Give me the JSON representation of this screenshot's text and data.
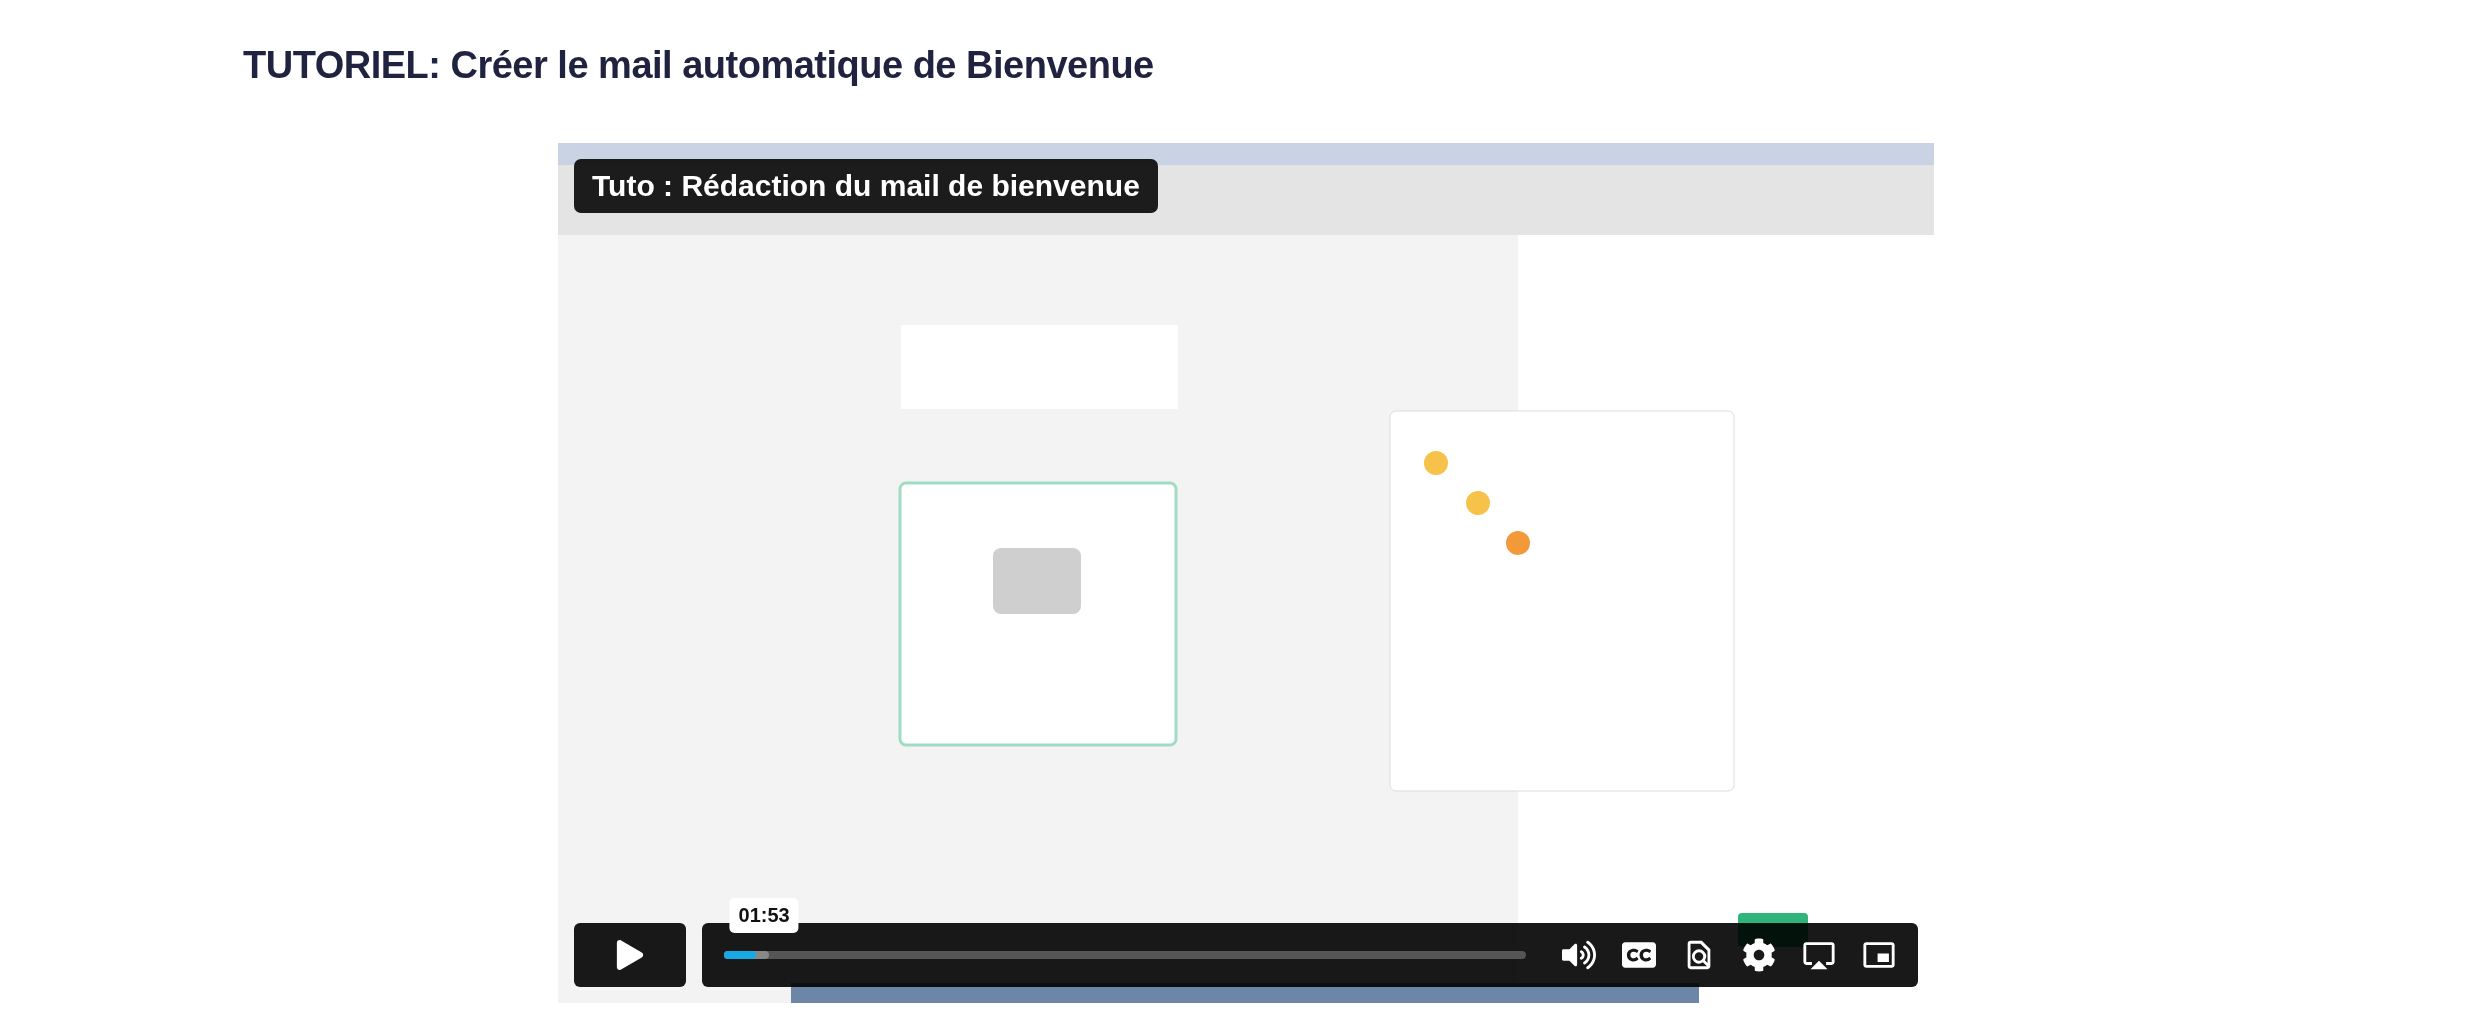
{
  "page": {
    "title": "TUTORIEL: Créer le mail automatique de Bienvenue"
  },
  "video": {
    "kind": "picture",
    "overlay_title": "Tuto : Rédaction du mail de bienvenue",
    "time_tooltip": "01:53",
    "progress": {
      "level": 0.04
    }
  }
}
